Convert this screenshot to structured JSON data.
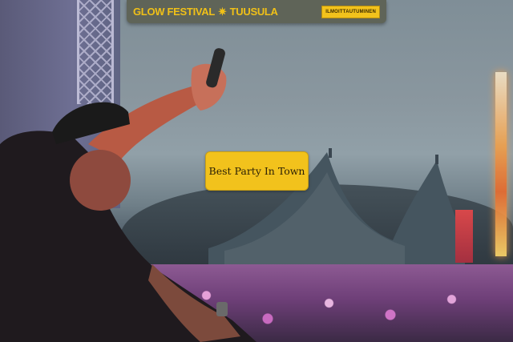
{
  "header": {
    "logo_left": "GLOW FESTIVAL",
    "logo_star": "✷",
    "logo_right": "TUUSULA",
    "signup_label": "ILMOITTAUTUMINEN"
  },
  "hero": {
    "cta_label": "Best Party In Town"
  },
  "colors": {
    "accent": "#f2c21c",
    "header_bg": "#5f6458"
  }
}
